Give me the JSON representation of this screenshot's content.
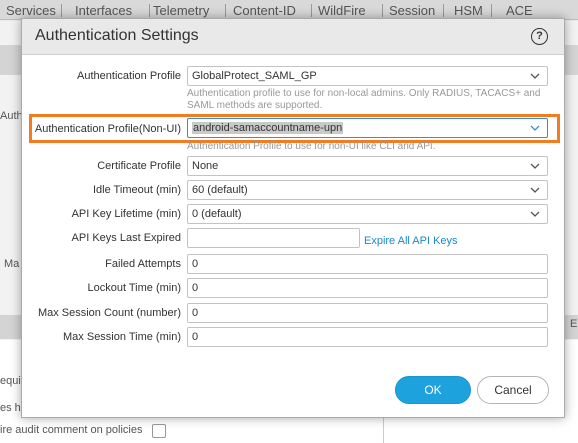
{
  "background": {
    "tabs": [
      "Services",
      "Interfaces",
      "Telemetry",
      "Content-ID",
      "WildFire",
      "Session",
      "HSM",
      "ACE"
    ],
    "fragments": {
      "left_auth": "Auth",
      "left_ma": "Ma",
      "left_requ": "equi",
      "left_es_ha": "es ha",
      "audit_comment": "ire audit comment on policies",
      "right_e": "E"
    }
  },
  "dialog": {
    "title": "Authentication Settings",
    "help_icon": "?",
    "fields": {
      "auth_profile": {
        "label": "Authentication Profile",
        "value": "GlobalProtect_SAML_GP",
        "help": "Authentication profile to use for non-local admins. Only RADIUS, TACACS+ and SAML methods are supported."
      },
      "auth_profile_nonui": {
        "label": "Authentication Profile(Non-UI)",
        "value": "android-samaccountname-upn",
        "help": "Authentication Profile to use for non-UI like CLI and API."
      },
      "certificate_profile": {
        "label": "Certificate Profile",
        "value": "None"
      },
      "idle_timeout": {
        "label": "Idle Timeout (min)",
        "value": "60 (default)"
      },
      "api_key_lifetime": {
        "label": "API Key Lifetime (min)",
        "value": "0 (default)"
      },
      "api_keys_last_expired": {
        "label": "API Keys Last Expired",
        "value": "",
        "link": "Expire All API Keys"
      },
      "failed_attempts": {
        "label": "Failed Attempts",
        "value": "0"
      },
      "lockout_time": {
        "label": "Lockout Time (min)",
        "value": "0"
      },
      "max_session_count": {
        "label": "Max Session Count (number)",
        "value": "0"
      },
      "max_session_time": {
        "label": "Max Session Time (min)",
        "value": "0"
      }
    },
    "buttons": {
      "ok": "OK",
      "cancel": "Cancel"
    }
  },
  "colors": {
    "accent": "#1ea2de",
    "highlight": "#f47c20",
    "link": "#1a8ac9"
  }
}
